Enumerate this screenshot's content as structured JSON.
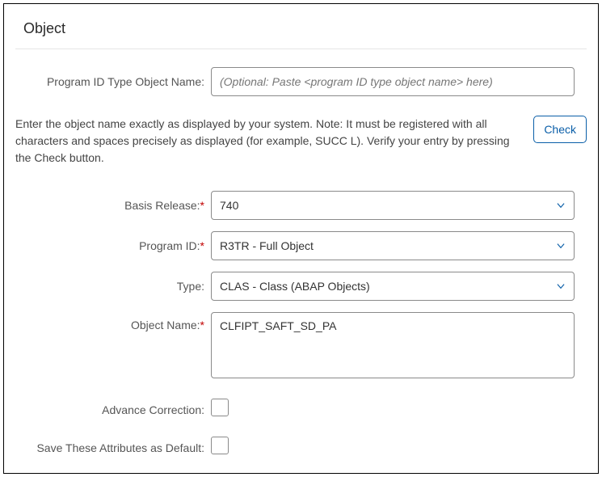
{
  "title": "Object",
  "program_id_type_object_name": {
    "label": "Program ID Type Object Name:",
    "placeholder": "(Optional: Paste <program ID type object name> here)",
    "value": ""
  },
  "help_text": "Enter the object name exactly as displayed by your system. Note: It must be registered with all characters and spaces precisely as displayed (for example, SUCC L). Verify your entry by pressing the Check button.",
  "check_button": "Check",
  "basis_release": {
    "label": "Basis Release:",
    "value": "740"
  },
  "program_id": {
    "label": "Program ID:",
    "value": "R3TR - Full Object"
  },
  "type": {
    "label": "Type:",
    "value": "CLAS - Class (ABAP Objects)"
  },
  "object_name": {
    "label": "Object Name:",
    "value": "CLFIPT_SAFT_SD_PA"
  },
  "advance_correction": {
    "label": "Advance Correction:",
    "checked": false
  },
  "save_default": {
    "label": "Save These Attributes as Default:",
    "checked": false
  }
}
